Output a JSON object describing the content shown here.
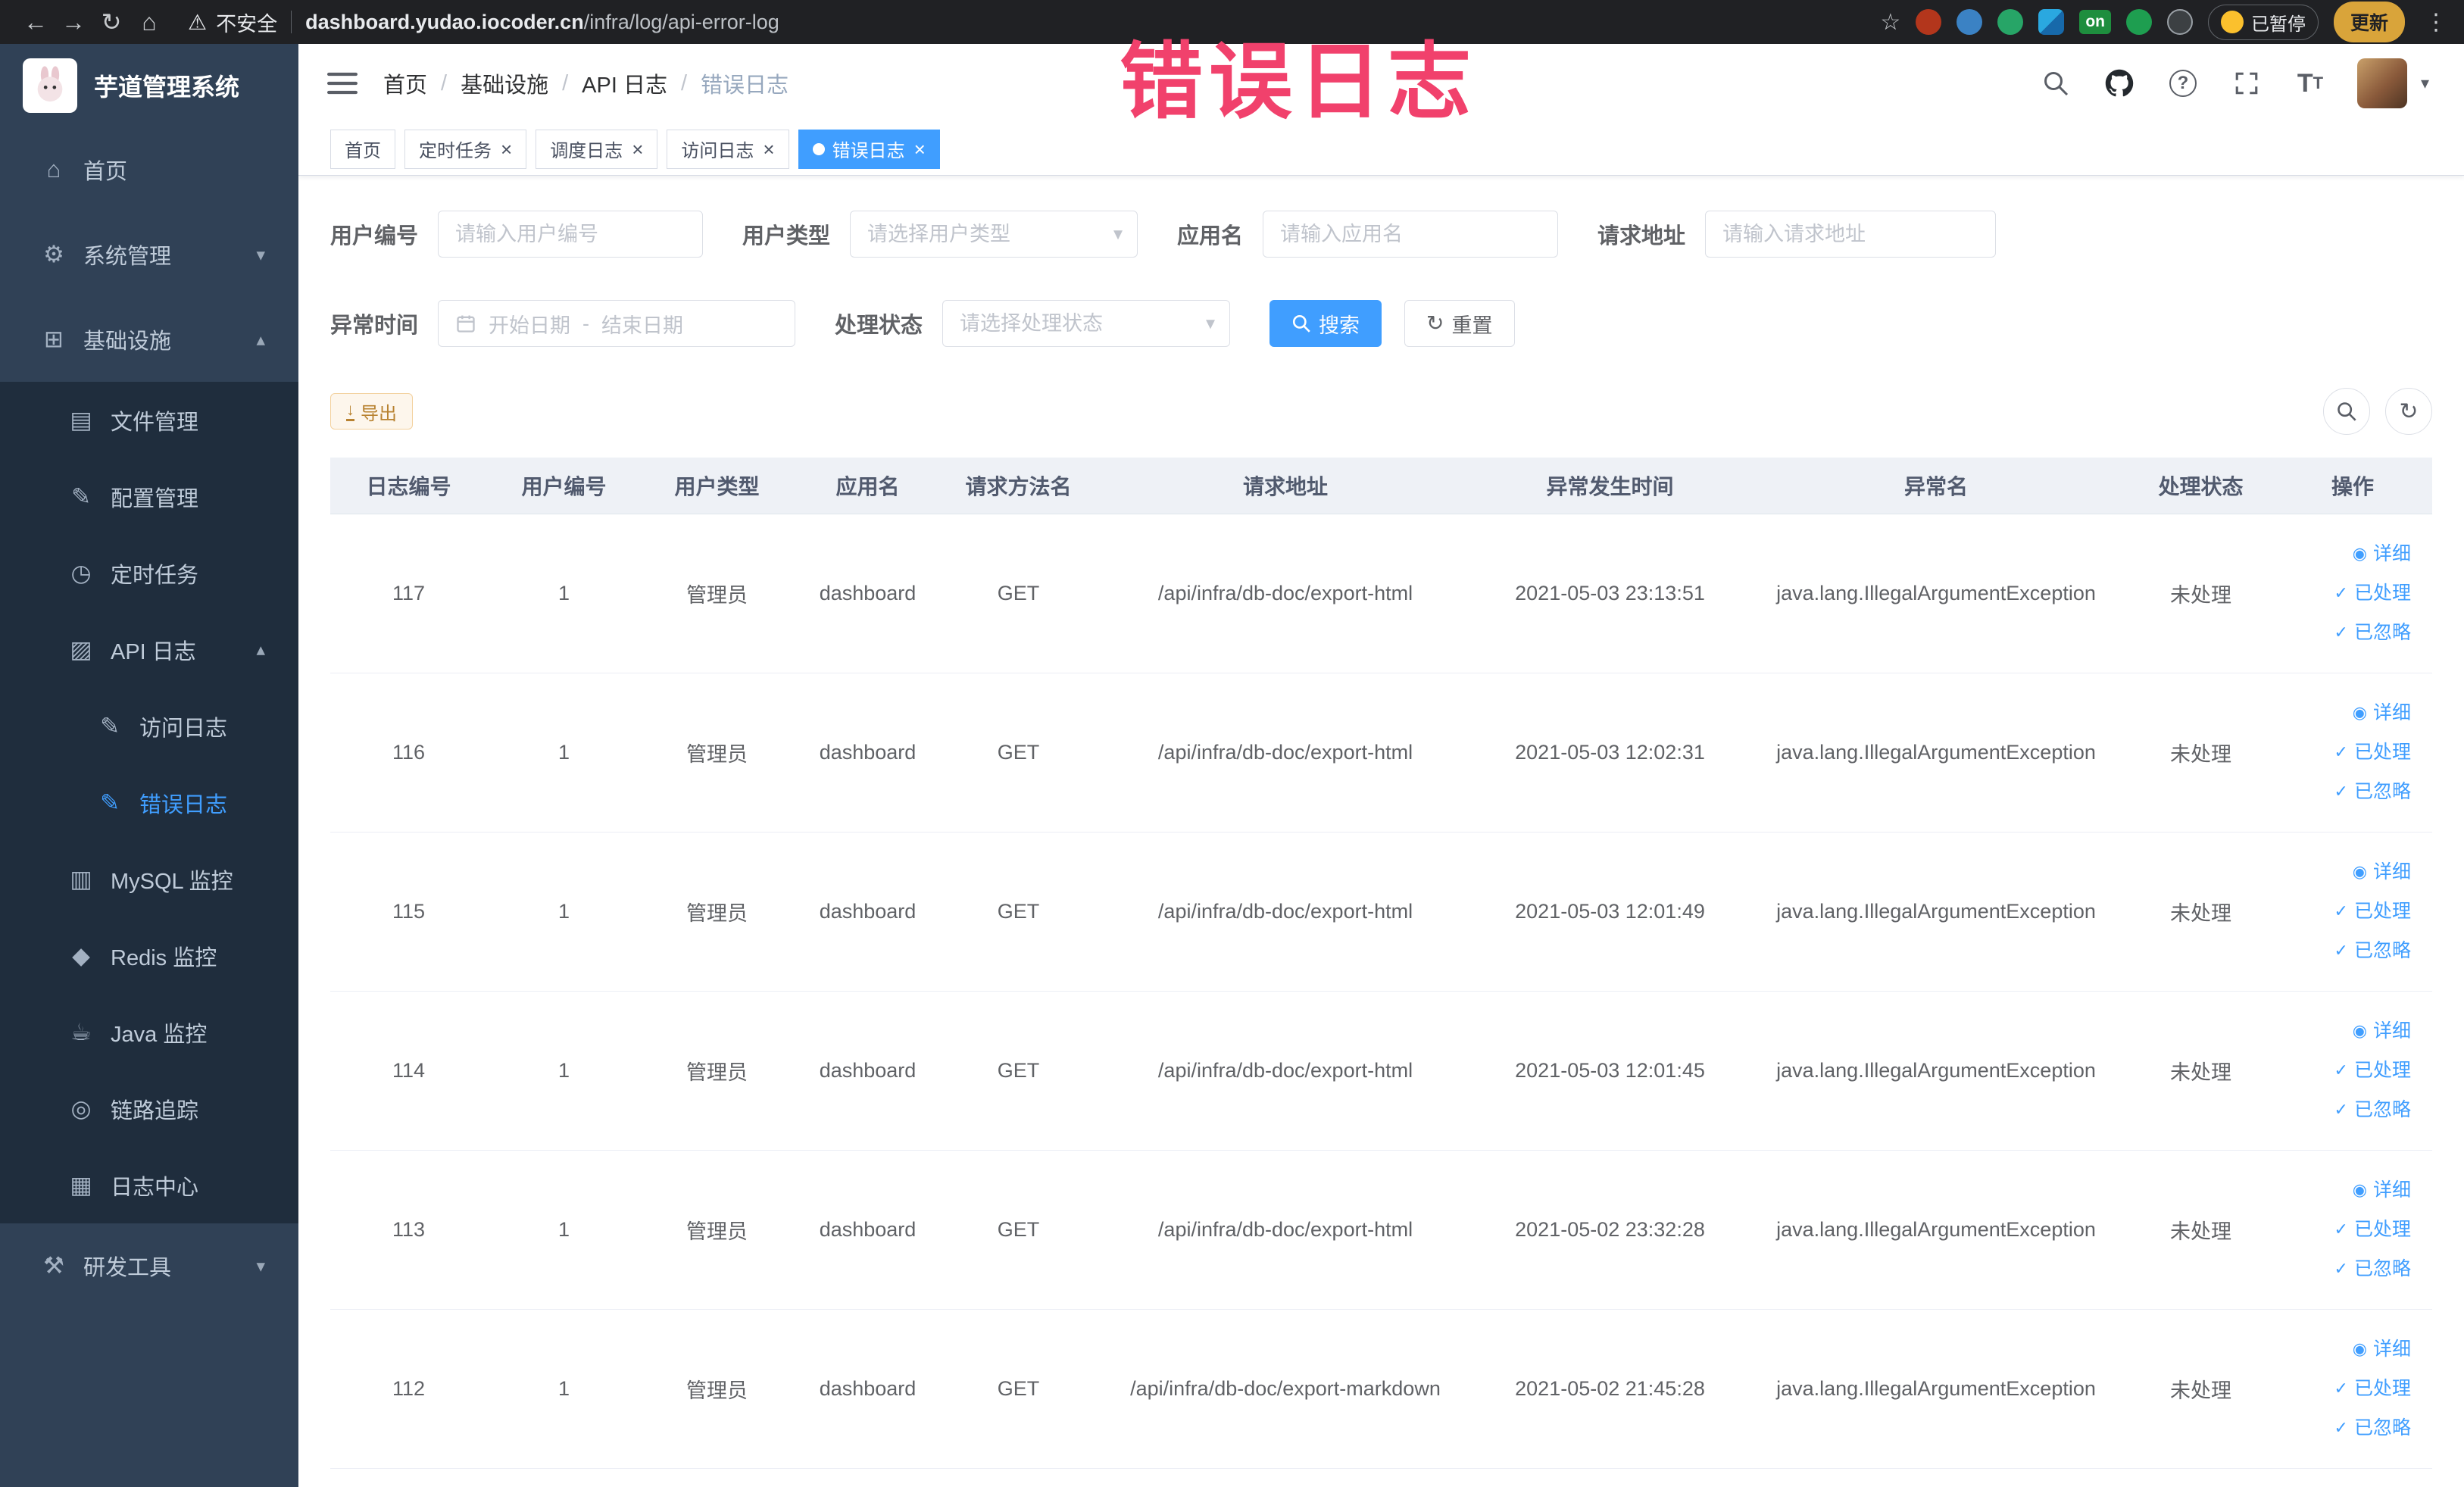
{
  "colors": {
    "accent": "#409eff",
    "annotation_pink": "#f1416c",
    "warning": "#e6a23c",
    "sidebar_bg": "#304156",
    "submenu_bg": "#1f2d3d",
    "chrome_bg": "#202124"
  },
  "browser": {
    "security_label": "不安全",
    "url_domain": "dashboard.yudao.iocoder.cn",
    "url_path": "/infra/log/api-error-log",
    "on_badge": "on",
    "paused_label": "已暂停",
    "update_label": "更新"
  },
  "annotation": {
    "text": "错误日志"
  },
  "sidebar": {
    "logo_title": "芋道管理系统",
    "items": [
      {
        "label": "首页",
        "icon": "home-icon",
        "level": 1,
        "sub": false,
        "active": false,
        "arrow": null
      },
      {
        "label": "系统管理",
        "icon": "gear-icon",
        "level": 1,
        "sub": false,
        "active": false,
        "arrow": "down"
      },
      {
        "label": "基础设施",
        "icon": "infra-icon",
        "level": 1,
        "sub": false,
        "active": false,
        "arrow": "up"
      },
      {
        "label": "文件管理",
        "icon": "file-icon",
        "level": 2,
        "sub": true,
        "active": false,
        "arrow": null
      },
      {
        "label": "配置管理",
        "icon": "config-icon",
        "level": 2,
        "sub": true,
        "active": false,
        "arrow": null
      },
      {
        "label": "定时任务",
        "icon": "timer-icon",
        "level": 2,
        "sub": true,
        "active": false,
        "arrow": null
      },
      {
        "label": "API 日志",
        "icon": "api-log-icon",
        "level": 2,
        "sub": true,
        "active": false,
        "arrow": "up"
      },
      {
        "label": "访问日志",
        "icon": "access-log-icon",
        "level": 3,
        "sub": true,
        "active": false,
        "arrow": null
      },
      {
        "label": "错误日志",
        "icon": "error-log-icon",
        "level": 3,
        "sub": true,
        "active": true,
        "arrow": null
      },
      {
        "label": "MySQL 监控",
        "icon": "mysql-icon",
        "level": 2,
        "sub": true,
        "active": false,
        "arrow": null
      },
      {
        "label": "Redis 监控",
        "icon": "redis-icon",
        "level": 2,
        "sub": true,
        "active": false,
        "arrow": null
      },
      {
        "label": "Java 监控",
        "icon": "java-icon",
        "level": 2,
        "sub": true,
        "active": false,
        "arrow": null
      },
      {
        "label": "链路追踪",
        "icon": "trace-icon",
        "level": 2,
        "sub": true,
        "active": false,
        "arrow": null
      },
      {
        "label": "日志中心",
        "icon": "log-center-icon",
        "level": 2,
        "sub": true,
        "active": false,
        "arrow": null
      },
      {
        "label": "研发工具",
        "icon": "tools-icon",
        "level": 1,
        "sub": false,
        "active": false,
        "arrow": "down"
      }
    ]
  },
  "header": {
    "breadcrumb": [
      "首页",
      "基础设施",
      "API 日志",
      "错误日志"
    ]
  },
  "tabs": [
    {
      "label": "首页",
      "closable": false,
      "active": false
    },
    {
      "label": "定时任务",
      "closable": true,
      "active": false
    },
    {
      "label": "调度日志",
      "closable": true,
      "active": false
    },
    {
      "label": "访问日志",
      "closable": true,
      "active": false
    },
    {
      "label": "错误日志",
      "closable": true,
      "active": true
    }
  ],
  "filters": {
    "user_id": {
      "label": "用户编号",
      "placeholder": "请输入用户编号"
    },
    "user_type": {
      "label": "用户类型",
      "placeholder": "请选择用户类型"
    },
    "app_name": {
      "label": "应用名",
      "placeholder": "请输入应用名"
    },
    "request_url": {
      "label": "请求地址",
      "placeholder": "请输入请求地址"
    },
    "exception_time": {
      "label": "异常时间",
      "start_placeholder": "开始日期",
      "separator": "-",
      "end_placeholder": "结束日期"
    },
    "process_status": {
      "label": "处理状态",
      "placeholder": "请选择处理状态"
    },
    "search_label": "搜索",
    "reset_label": "重置"
  },
  "toolbar": {
    "export_label": "导出"
  },
  "table": {
    "columns": [
      "日志编号",
      "用户编号",
      "用户类型",
      "应用名",
      "请求方法名",
      "请求地址",
      "异常发生时间",
      "异常名",
      "处理状态",
      "操作"
    ],
    "actions": [
      {
        "label": "详细",
        "icon": "eye-icon",
        "name": "detail-link"
      },
      {
        "label": "已处理",
        "icon": "check-icon",
        "name": "processed-link"
      },
      {
        "label": "已忽略",
        "icon": "check-icon",
        "name": "ignored-link"
      }
    ],
    "rows": [
      {
        "id": "117",
        "user_id": "1",
        "user_type": "管理员",
        "app": "dashboard",
        "method": "GET",
        "url": "/api/infra/db-doc/export-html",
        "time": "2021-05-03 23:13:51",
        "exception": "java.lang.IllegalArgumentException",
        "status": "未处理"
      },
      {
        "id": "116",
        "user_id": "1",
        "user_type": "管理员",
        "app": "dashboard",
        "method": "GET",
        "url": "/api/infra/db-doc/export-html",
        "time": "2021-05-03 12:02:31",
        "exception": "java.lang.IllegalArgumentException",
        "status": "未处理"
      },
      {
        "id": "115",
        "user_id": "1",
        "user_type": "管理员",
        "app": "dashboard",
        "method": "GET",
        "url": "/api/infra/db-doc/export-html",
        "time": "2021-05-03 12:01:49",
        "exception": "java.lang.IllegalArgumentException",
        "status": "未处理"
      },
      {
        "id": "114",
        "user_id": "1",
        "user_type": "管理员",
        "app": "dashboard",
        "method": "GET",
        "url": "/api/infra/db-doc/export-html",
        "time": "2021-05-03 12:01:45",
        "exception": "java.lang.IllegalArgumentException",
        "status": "未处理"
      },
      {
        "id": "113",
        "user_id": "1",
        "user_type": "管理员",
        "app": "dashboard",
        "method": "GET",
        "url": "/api/infra/db-doc/export-html",
        "time": "2021-05-02 23:32:28",
        "exception": "java.lang.IllegalArgumentException",
        "status": "未处理"
      },
      {
        "id": "112",
        "user_id": "1",
        "user_type": "管理员",
        "app": "dashboard",
        "method": "GET",
        "url": "/api/infra/db-doc/export-markdown",
        "time": "2021-05-02 21:45:28",
        "exception": "java.lang.IllegalArgumentException",
        "status": "未处理"
      }
    ]
  }
}
